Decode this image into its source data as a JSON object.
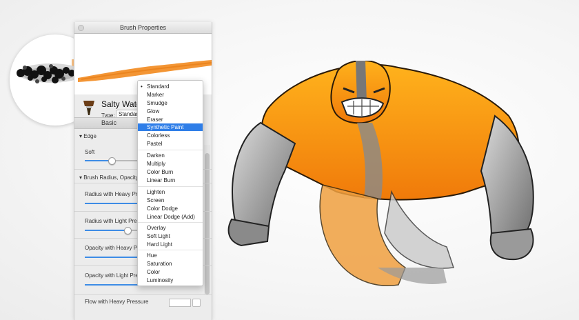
{
  "panel": {
    "title": "Brush Properties",
    "brush_name": "Salty Water",
    "type_label": "Type:",
    "type_value": "Standard",
    "tab_basic": "Basic",
    "edge_section": "Edge",
    "soft_label": "Soft",
    "radius_section": "Brush Radius, Opacity",
    "radius_heavy": "Radius with Heavy Pressure",
    "radius_light": "Radius with Light Pressure",
    "opacity_heavy": "Opacity with Heavy Pressure",
    "opacity_light": "Opacity with Light Pressure",
    "flow_heavy": "Flow with Heavy Pressure"
  },
  "menu": {
    "items_group1": [
      "Standard",
      "Marker",
      "Smudge",
      "Glow",
      "Eraser",
      "Synthetic Paint",
      "Colorless",
      "Pastel"
    ],
    "items_group2": [
      "Darken",
      "Multiply",
      "Color Burn",
      "Linear Burn"
    ],
    "items_group3": [
      "Lighten",
      "Screen",
      "Color Dodge",
      "Linear Dodge (Add)"
    ],
    "items_group4": [
      "Overlay",
      "Soft Light",
      "Hard Light"
    ],
    "items_group5": [
      "Hue",
      "Saturation",
      "Color",
      "Luminosity"
    ],
    "checked_item": "Standard",
    "highlighted_item": "Synthetic Paint"
  },
  "colors": {
    "stroke_orange": "#f28a1e",
    "selection_blue": "#2f7ee8",
    "slider_blue": "#3d8ce6"
  }
}
